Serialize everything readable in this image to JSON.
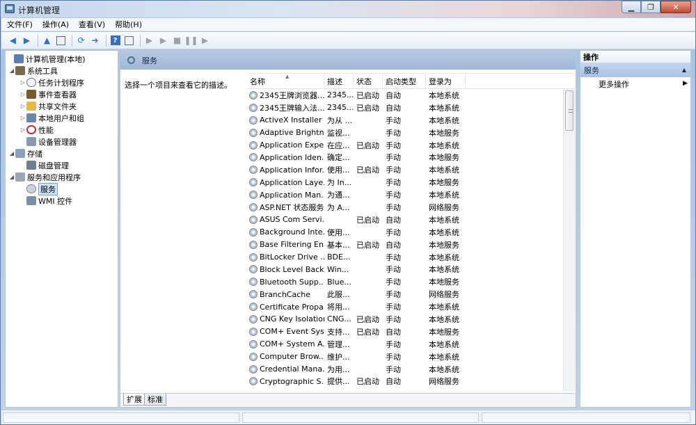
{
  "window": {
    "title": "计算机管理"
  },
  "menu": [
    "文件(F)",
    "操作(A)",
    "查看(V)",
    "帮助(H)"
  ],
  "tree": {
    "root": "计算机管理(本地)",
    "system_tools": "系统工具",
    "task_scheduler": "任务计划程序",
    "event_viewer": "事件查看器",
    "shared_folders": "共享文件夹",
    "local_users": "本地用户和组",
    "performance": "性能",
    "device_manager": "设备管理器",
    "storage": "存储",
    "disk_mgmt": "磁盘管理",
    "services_apps": "服务和应用程序",
    "services": "服务",
    "wmi": "WMI 控件"
  },
  "center": {
    "title": "服务",
    "description": "选择一个项目来查看它的描述。",
    "columns": {
      "name": "名称",
      "desc": "描述",
      "state": "状态",
      "start": "启动类型",
      "logon": "登录为"
    },
    "rows": [
      {
        "name": "2345王牌浏览器...",
        "desc": "2345...",
        "state": "已启动",
        "start": "自动",
        "logon": "本地系统"
      },
      {
        "name": "2345王牌输入法...",
        "desc": "2345...",
        "state": "已启动",
        "start": "自动",
        "logon": "本地系统"
      },
      {
        "name": "ActiveX Installer ...",
        "desc": "为从 ...",
        "state": "",
        "start": "手动",
        "logon": "本地系统"
      },
      {
        "name": "Adaptive Brightn...",
        "desc": "监视...",
        "state": "",
        "start": "手动",
        "logon": "本地服务"
      },
      {
        "name": "Application Expe...",
        "desc": "在应...",
        "state": "已启动",
        "start": "手动",
        "logon": "本地系统"
      },
      {
        "name": "Application Iden...",
        "desc": "确定...",
        "state": "",
        "start": "手动",
        "logon": "本地服务"
      },
      {
        "name": "Application Infor...",
        "desc": "使用...",
        "state": "已启动",
        "start": "手动",
        "logon": "本地系统"
      },
      {
        "name": "Application Laye...",
        "desc": "为 In...",
        "state": "",
        "start": "手动",
        "logon": "本地服务"
      },
      {
        "name": "Application Man...",
        "desc": "为通...",
        "state": "",
        "start": "手动",
        "logon": "本地系统"
      },
      {
        "name": "ASP.NET 状态服务",
        "desc": "为 A...",
        "state": "",
        "start": "手动",
        "logon": "网络服务"
      },
      {
        "name": "ASUS Com Servi...",
        "desc": "",
        "state": "已启动",
        "start": "自动",
        "logon": "本地系统"
      },
      {
        "name": "Background Inte...",
        "desc": "使用...",
        "state": "",
        "start": "手动",
        "logon": "本地系统"
      },
      {
        "name": "Base Filtering En...",
        "desc": "基本...",
        "state": "已启动",
        "start": "自动",
        "logon": "本地服务"
      },
      {
        "name": "BitLocker Drive ...",
        "desc": "BDE...",
        "state": "",
        "start": "手动",
        "logon": "本地系统"
      },
      {
        "name": "Block Level Back...",
        "desc": "Win...",
        "state": "",
        "start": "手动",
        "logon": "本地系统"
      },
      {
        "name": "Bluetooth Supp...",
        "desc": "Blue...",
        "state": "",
        "start": "手动",
        "logon": "本地服务"
      },
      {
        "name": "BranchCache",
        "desc": "此服...",
        "state": "",
        "start": "手动",
        "logon": "网络服务"
      },
      {
        "name": "Certificate Propa...",
        "desc": "将用...",
        "state": "",
        "start": "手动",
        "logon": "本地系统"
      },
      {
        "name": "CNG Key Isolation",
        "desc": "CNG...",
        "state": "已启动",
        "start": "手动",
        "logon": "本地系统"
      },
      {
        "name": "COM+ Event Sys...",
        "desc": "支持...",
        "state": "已启动",
        "start": "自动",
        "logon": "本地服务"
      },
      {
        "name": "COM+ System A...",
        "desc": "管理...",
        "state": "",
        "start": "手动",
        "logon": "本地系统"
      },
      {
        "name": "Computer Brow...",
        "desc": "维护...",
        "state": "",
        "start": "手动",
        "logon": "本地系统"
      },
      {
        "name": "Credential Mana...",
        "desc": "为用...",
        "state": "",
        "start": "手动",
        "logon": "本地系统"
      },
      {
        "name": "Cryptographic S...",
        "desc": "提供...",
        "state": "已启动",
        "start": "自动",
        "logon": "网络服务"
      }
    ],
    "tabs": [
      "扩展",
      "标准"
    ]
  },
  "actions": {
    "header": "操作",
    "group": "服务",
    "more": "更多操作"
  }
}
